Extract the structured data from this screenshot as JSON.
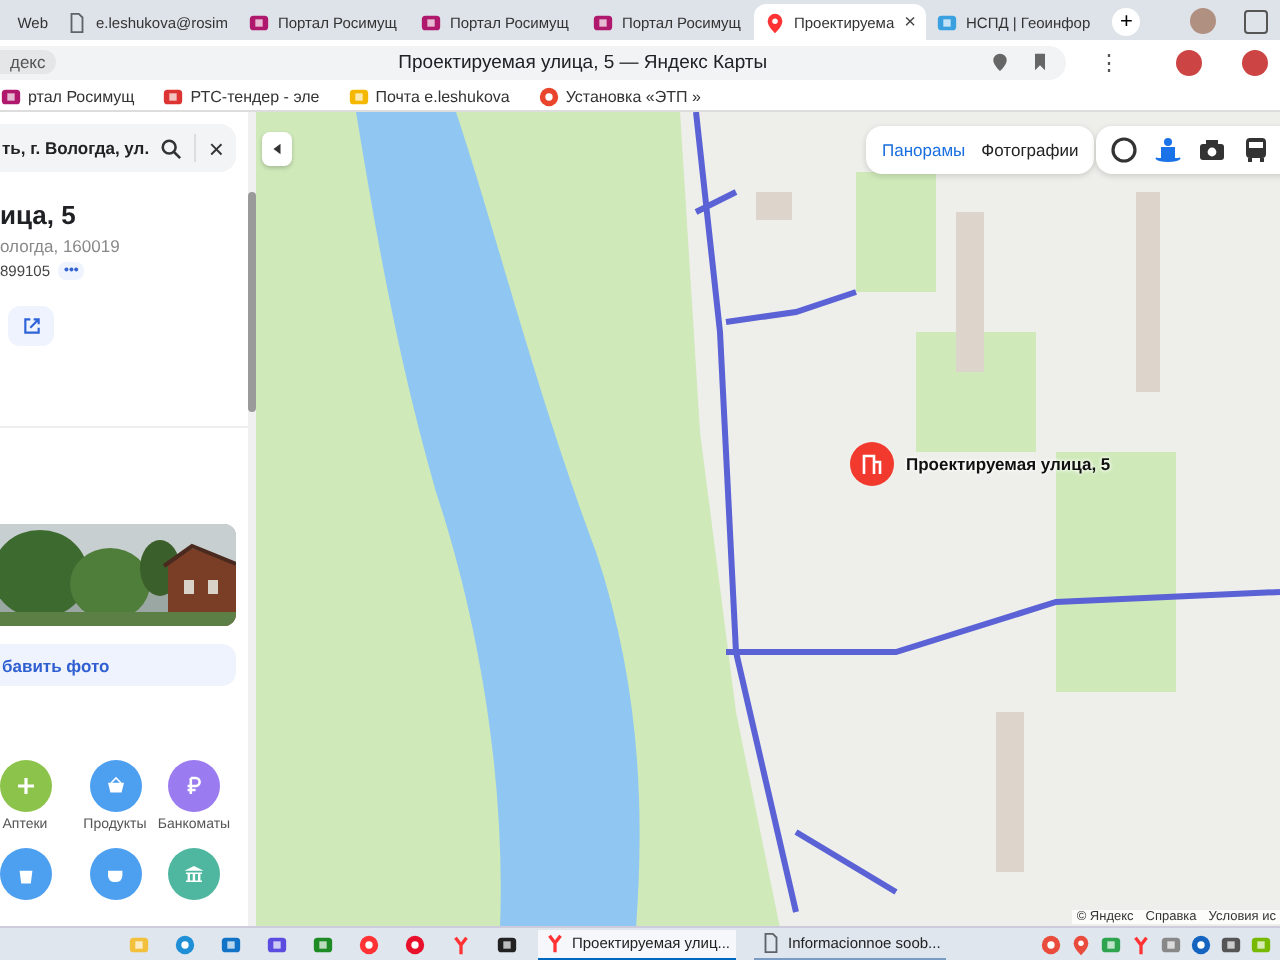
{
  "browser": {
    "tabs": [
      {
        "title": "Web",
        "kind": "none",
        "selected": false
      },
      {
        "title": "e.leshukova@rosim",
        "kind": "doc",
        "selected": false
      },
      {
        "title": "Портал Росимущ",
        "kind": "portal",
        "selected": false
      },
      {
        "title": "Портал Росимущ",
        "kind": "portal",
        "selected": false
      },
      {
        "title": "Портал Росимущ",
        "kind": "portal",
        "selected": false
      },
      {
        "title": "Проектируема",
        "kind": "maps",
        "selected": true,
        "close": "×"
      },
      {
        "title": "НСПД | Геоинфор",
        "kind": "nspd",
        "selected": false
      }
    ],
    "new_tab": "+",
    "address_bar": {
      "chip": "декс",
      "title": "Проектируемая улица, 5 — Яндекс Карты",
      "menu": "⋮"
    },
    "bookmarks": [
      {
        "label": "ртал Росимущ",
        "kind": "portal"
      },
      {
        "label": "РТС-тендер - эле",
        "kind": "rts"
      },
      {
        "label": "Почта e.leshukova",
        "kind": "mail"
      },
      {
        "label": "Установка «ЭТП »",
        "kind": "etp"
      }
    ]
  },
  "sidebar": {
    "search_value": "ть, г. Вологда, ул.",
    "close": "×",
    "title": "ица, 5",
    "address": "ологда, 160019",
    "code": "899105",
    "more": "•••",
    "add_photo": "бавить фото",
    "categories": [
      {
        "label": "Аптеки",
        "kind": "pharmacy",
        "color": "#8cc34b"
      },
      {
        "label": "Продукты",
        "kind": "grocery",
        "color": "#4d9ff0"
      },
      {
        "label": "Банкоматы",
        "kind": "atm",
        "color": "#9a7cf0"
      },
      {
        "kind": "shop",
        "color": "#4d9ff0"
      },
      {
        "kind": "cafe",
        "color": "#4d9ff0"
      },
      {
        "kind": "museum",
        "color": "#4fb79f"
      }
    ]
  },
  "map": {
    "layers": [
      {
        "label": "Панорамы",
        "selected": true
      },
      {
        "label": "Фотографии",
        "selected": false
      }
    ],
    "tools": [
      {
        "kind": "ring",
        "selected": false
      },
      {
        "kind": "panorama",
        "selected": true
      },
      {
        "kind": "camera",
        "selected": false
      },
      {
        "kind": "bus",
        "selected": false
      }
    ],
    "marker": {
      "label": "Проектируемая улица, 5"
    },
    "attribution": [
      "© Яндекс",
      "Справка",
      "Условия ис"
    ]
  },
  "taskbar": {
    "apps": [
      {
        "kind": "explorer"
      },
      {
        "kind": "edge"
      },
      {
        "kind": "outlook"
      },
      {
        "kind": "editor"
      },
      {
        "kind": "xbox"
      },
      {
        "kind": "yandex"
      },
      {
        "kind": "opera"
      },
      {
        "kind": "yandex-y"
      },
      {
        "kind": "bat"
      }
    ],
    "windows": [
      {
        "label": "Проектируемая улиц...",
        "kind": "yandex-y",
        "selected": true
      },
      {
        "label": "Informacionnoe soob...",
        "kind": "doc",
        "selected": false
      }
    ],
    "tray": [
      {
        "kind": "record"
      },
      {
        "kind": "pin"
      },
      {
        "kind": "green"
      },
      {
        "kind": "yandex-y"
      },
      {
        "kind": "usb"
      },
      {
        "kind": "bluetooth"
      },
      {
        "kind": "shield"
      },
      {
        "kind": "nvidia"
      }
    ]
  }
}
